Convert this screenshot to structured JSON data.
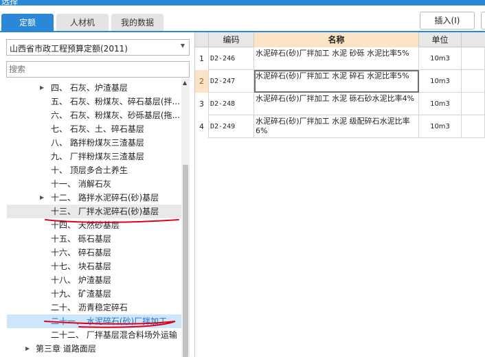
{
  "app": {
    "title": "选择"
  },
  "tabs": [
    {
      "label": "定额"
    },
    {
      "label": "人材机"
    },
    {
      "label": "我的数据"
    }
  ],
  "toolbar": {
    "insert_label": "插入(I)"
  },
  "left": {
    "library_select": "山西省市政工程预算定额(2011)",
    "search_placeholder": "搜索",
    "tree": [
      {
        "label": "四、  石灰、炉渣基层",
        "expandable": true
      },
      {
        "label": "五、  石灰、粉煤灰、碎石基层(拌..."
      },
      {
        "label": "六、  石灰、粉煤灰、砂砾基层(拖..."
      },
      {
        "label": "七、  石灰、土、碎石基层"
      },
      {
        "label": "八、  路拌粉煤灰三渣基层"
      },
      {
        "label": "九、  厂拌粉煤灰三渣基层"
      },
      {
        "label": "十、  顶层多合土养生"
      },
      {
        "label": "十一、  消解石灰"
      },
      {
        "label": "十二、  路拌水泥碎石(砂)基层",
        "expandable": true
      },
      {
        "label": "十三、  厂拌水泥碎石(砂)基层",
        "state": "hover"
      },
      {
        "label": "十四、  天然砂基层"
      },
      {
        "label": "十五、  砾石基层"
      },
      {
        "label": "十六、  碎石基层"
      },
      {
        "label": "十七、  块石基层"
      },
      {
        "label": "十八、  炉渣基层"
      },
      {
        "label": "十九、  矿渣基层"
      },
      {
        "label": "二十、  沥青稳定碎石"
      },
      {
        "label": "二十一、  水泥碎石(砂)厂拌加工",
        "state": "selected"
      },
      {
        "label": "二十二、  厂拌基层混合料场外运输"
      },
      {
        "label": "第三章  道路面层",
        "chapter": true,
        "expandable": true
      }
    ]
  },
  "table": {
    "headers": {
      "code": "编码",
      "name": "名称",
      "unit": "单位"
    },
    "rows": [
      {
        "index": "1",
        "code": "D2-246",
        "name": "水泥碎石(砂)厂拌加工 水泥 砂砾 水泥比率5%",
        "unit": "10m3"
      },
      {
        "index": "2",
        "code": "D2-247",
        "name": "水泥碎石(砂)厂拌加工 水泥 碎石 水泥比率5%",
        "unit": "10m3",
        "active": true
      },
      {
        "index": "3",
        "code": "D2-248",
        "name": "水泥碎石(砂)厂拌加工 水泥 砾石砂水泥比率4%",
        "unit": "10m3"
      },
      {
        "index": "4",
        "code": "D2-249",
        "name": "水泥碎石(砂)厂拌加工 水泥 级配碎石水泥比率6%",
        "unit": "10m3"
      }
    ]
  },
  "colors": {
    "accent": "#2b87d8",
    "header_highlight": "#fbe4c6",
    "selected_row": "#cde6fa",
    "annotation": "#e0001a"
  }
}
